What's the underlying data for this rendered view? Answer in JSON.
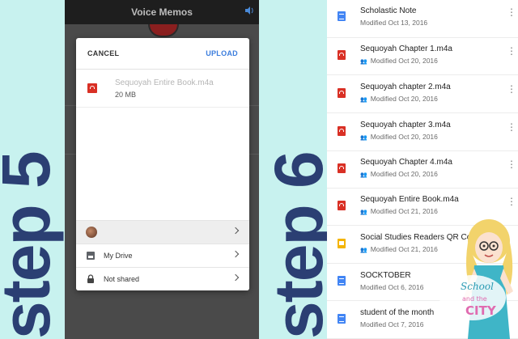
{
  "step5": {
    "label": "step 5",
    "app_title": "Voice Memos",
    "dialog": {
      "cancel": "CANCEL",
      "upload": "UPLOAD",
      "file_name": "Sequoyah Entire Book.m4a",
      "file_size": "20 MB",
      "rows": [
        {
          "label": "",
          "icon": "avatar"
        },
        {
          "label": "My Drive",
          "icon": "drive-icon"
        },
        {
          "label": "Not shared",
          "icon": "lock-icon"
        }
      ]
    }
  },
  "step6": {
    "label": "step 6",
    "files": [
      {
        "name": "Scholastic Note",
        "meta": "Modified Oct 13, 2016",
        "type": "doc",
        "shared": false
      },
      {
        "name": "Sequoyah Chapter 1.m4a",
        "meta": "Modified Oct 20, 2016",
        "type": "audio",
        "shared": true
      },
      {
        "name": "Sequoyah chapter 2.m4a",
        "meta": "Modified Oct 20, 2016",
        "type": "audio",
        "shared": true
      },
      {
        "name": "Sequoyah chapter 3.m4a",
        "meta": "Modified Oct 20, 2016",
        "type": "audio",
        "shared": true
      },
      {
        "name": "Sequoyah Chapter 4.m4a",
        "meta": "Modified Oct 20, 2016",
        "type": "audio",
        "shared": true
      },
      {
        "name": "Sequoyah Entire Book.m4a",
        "meta": "Modified Oct 21, 2016",
        "type": "audio",
        "shared": true
      },
      {
        "name": "Social Studies Readers QR Codes",
        "meta": "Modified Oct 21, 2016",
        "type": "slides",
        "shared": true
      },
      {
        "name": "SOCKTOBER",
        "meta": "Modified Oct 6, 2016",
        "type": "doc",
        "shared": false
      },
      {
        "name": "student of the month",
        "meta": "Modified Oct 7, 2016",
        "type": "doc",
        "shared": false
      }
    ]
  },
  "brand": {
    "line1": "School",
    "line2": "and the",
    "line3": "CITY"
  },
  "colors": {
    "background": "#c8f2ef",
    "step_text": "#2b3f73",
    "upload": "#3b7ddd",
    "audio": "#d93025",
    "doc": "#4285f4",
    "slides": "#f4b400"
  }
}
